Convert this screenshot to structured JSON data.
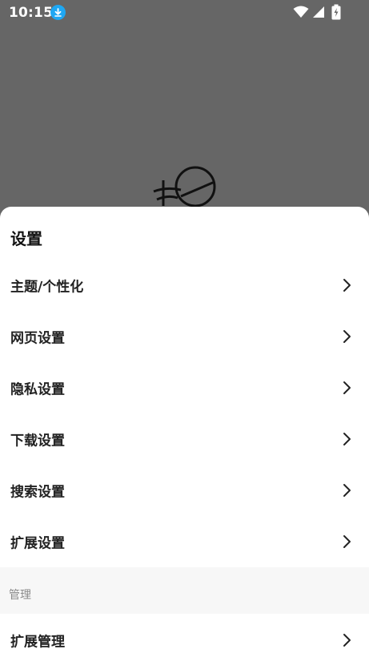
{
  "status_bar": {
    "time": "10:15",
    "icons": [
      "download-icon",
      "wifi-icon",
      "signal-icon",
      "battery-charging-icon"
    ]
  },
  "sheet": {
    "title": "设置",
    "items": [
      {
        "label": "主题/个性化",
        "icon": "chevron-right-icon"
      },
      {
        "label": "网页设置",
        "icon": "chevron-right-icon"
      },
      {
        "label": "隐私设置",
        "icon": "chevron-right-icon"
      },
      {
        "label": "下载设置",
        "icon": "chevron-right-icon"
      },
      {
        "label": "搜索设置",
        "icon": "chevron-right-icon"
      },
      {
        "label": "扩展设置",
        "icon": "chevron-right-icon"
      }
    ],
    "section_header": "管理",
    "manage_items": [
      {
        "label": "扩展管理",
        "icon": "chevron-right-icon"
      }
    ]
  },
  "colors": {
    "backdrop": "#666666",
    "sheet": "#ffffff",
    "section_bg": "#f7f7f7",
    "download_badge": "#1ea7f3"
  }
}
